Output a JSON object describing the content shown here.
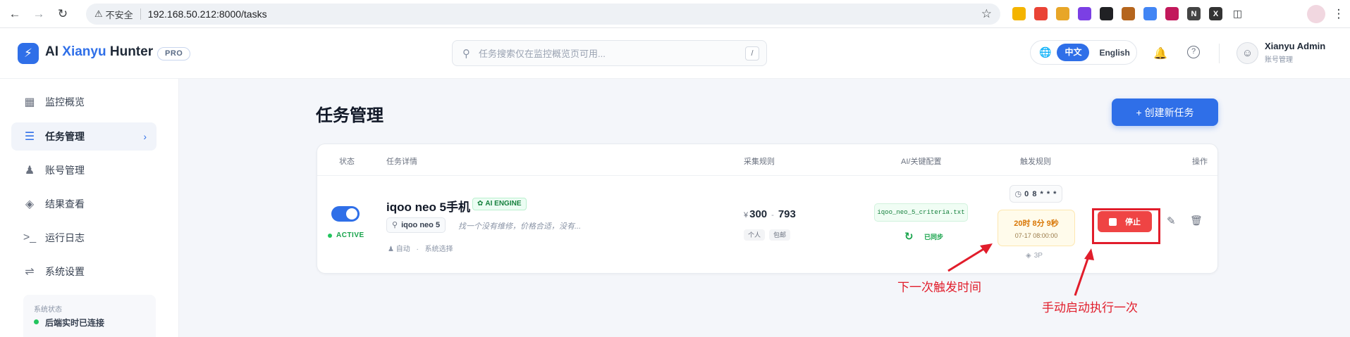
{
  "browser": {
    "insecure_label": "不安全",
    "url": "192.168.50.212:8000/tasks"
  },
  "app": {
    "brand_prefix": "AI ",
    "brand_highlight": "Xianyu",
    "brand_suffix": " Hunter",
    "badge": "PRO",
    "search_placeholder": "任务搜索仅在监控概览页可用...",
    "search_shortcut": "/",
    "lang_zh": "中文",
    "lang_en": "English",
    "user_name": "Xianyu Admin",
    "user_role": "账号管理"
  },
  "sidebar": {
    "items": [
      {
        "label": "监控概览",
        "icon": "grid-icon"
      },
      {
        "label": "任务管理",
        "icon": "checklist-icon",
        "active": true
      },
      {
        "label": "账号管理",
        "icon": "users-icon"
      },
      {
        "label": "结果查看",
        "icon": "layers-icon"
      },
      {
        "label": "运行日志",
        "icon": "terminal-icon"
      },
      {
        "label": "系统设置",
        "icon": "sliders-icon"
      }
    ],
    "status_title": "系统状态",
    "status_text": "后端实时已连接"
  },
  "main": {
    "title": "任务管理",
    "create_button": "+ 创建新任务",
    "columns": [
      "状态",
      "任务详情",
      "采集规则",
      "AI/关键配置",
      "触发规则",
      "操作"
    ],
    "task": {
      "active_label": "ACTIVE",
      "enabled": true,
      "name": "iqoo neo 5手机",
      "ai_badge": "AI ENGINE",
      "keyword": "iqoo neo 5",
      "description": "找一个没有维修，价格合适，没有...",
      "meta_mode": "自动",
      "meta_sep": "·",
      "meta_region": "系统选择",
      "currency": "¥",
      "price_min": "300",
      "price_sep": "-",
      "price_max": "793",
      "tags": [
        "个人",
        "包邮"
      ],
      "criteria_file": "iqoo_neo_5_criteria.txt",
      "sync_label": "已同步",
      "cron": "0 8 * * *",
      "countdown": "20时 8分 9秒",
      "next_run": "07-17 08:00:00",
      "pages": "3P",
      "stop_label": "停止"
    }
  },
  "annotations": {
    "next_trigger": "下一次触发时间",
    "manual_run": "手动启动执行一次",
    "color": "#e11d2b"
  }
}
